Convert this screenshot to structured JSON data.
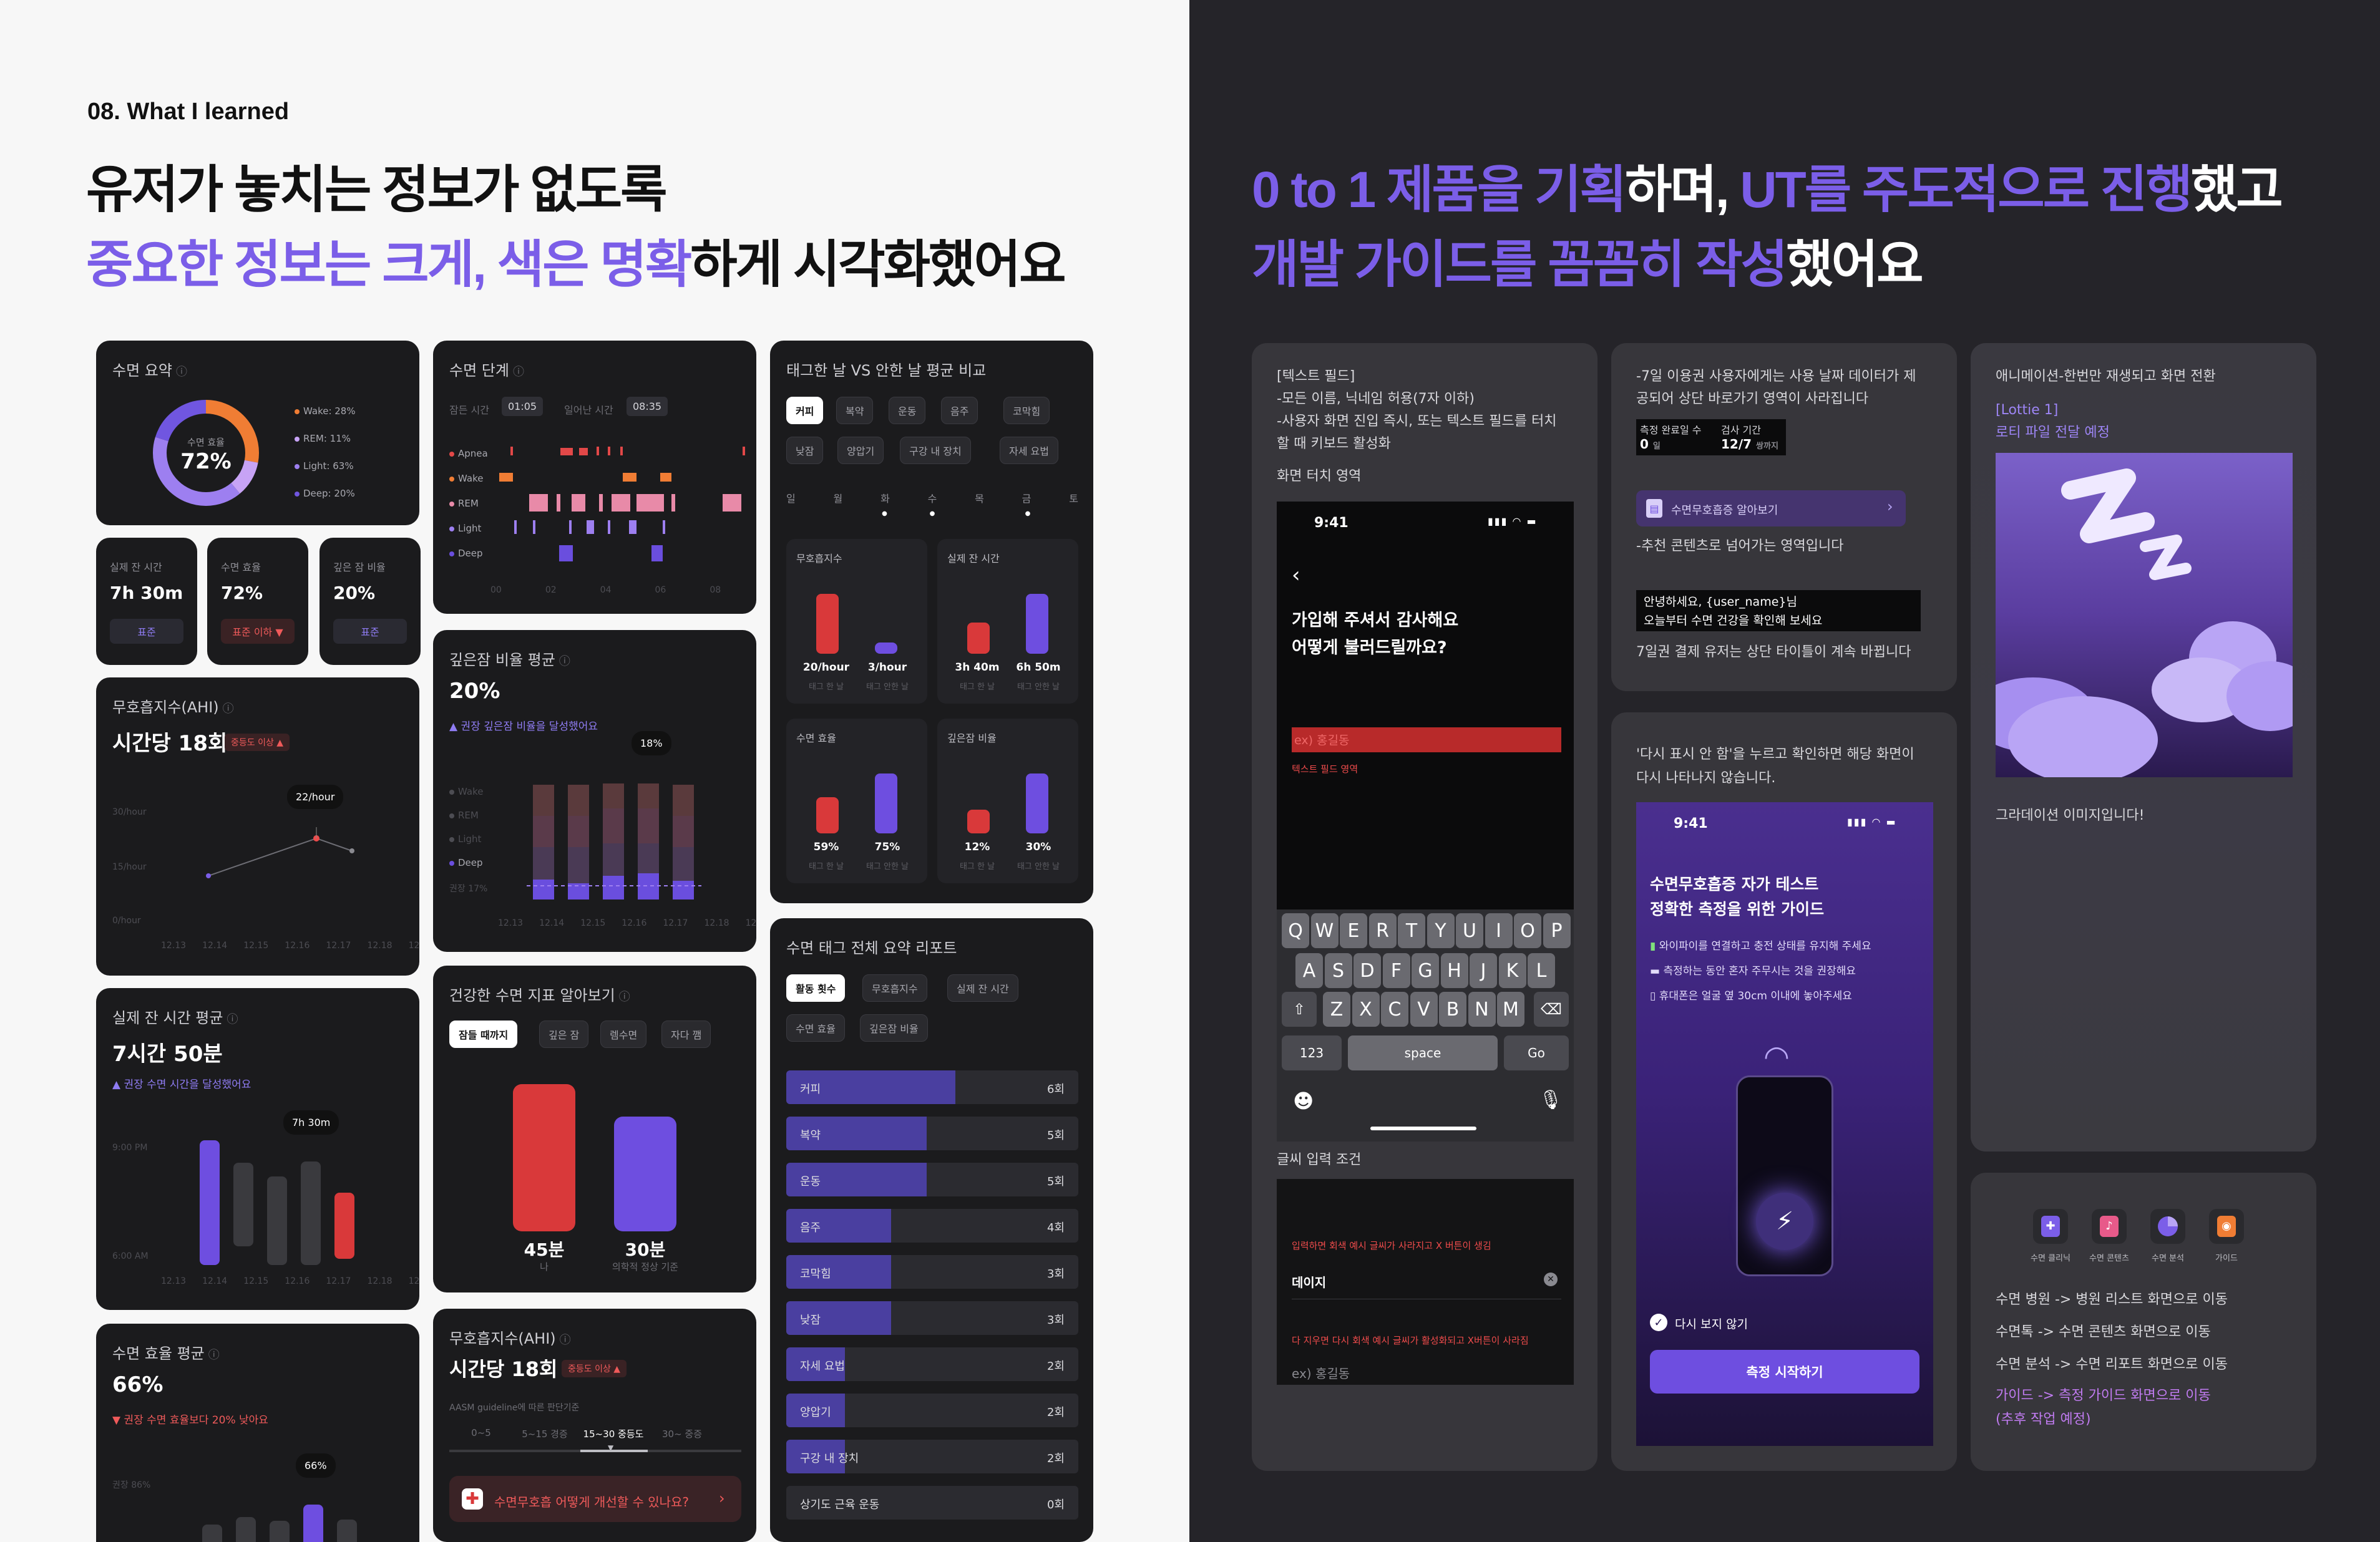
{
  "left_header": {
    "eyebrow": "08. What I learned",
    "line1": "유저가 놓치는 정보가 없도록",
    "line2_accent": "중요한 정보는 크게, 색은 명확",
    "line2_rest": "하게 시각화했어요"
  },
  "right_header": {
    "l1_a": "0 to 1 제품을 기획",
    "l1_b": "하며, ",
    "l1_c": "UT를 주도적으로 진행",
    "l1_d": "했고",
    "l2_a": "개발 가이드를 꼼꼼히 작성",
    "l2_b": "했어요"
  },
  "sleep_summary": {
    "title": "수면 요약",
    "center_label": "수면 효율",
    "center_value": "72%",
    "legend": [
      "Wake: 28%",
      "REM: 11%",
      "Light: 63%",
      "Deep: 20%"
    ],
    "colors": {
      "wake": "#f07d34",
      "rem": "#c7a3f5",
      "light": "#9d7ff0",
      "deep": "#7056e0"
    }
  },
  "mini_stats": [
    {
      "title": "실제 잔 시간",
      "value": "7h 30m",
      "badge": "표준"
    },
    {
      "title": "수면 효율",
      "value": "72%",
      "badge": "표준 이하 ▼"
    },
    {
      "title": "깊은 잠 비율",
      "value": "20%",
      "badge": "표준"
    }
  ],
  "ahi": {
    "title": "무호흡지수(AHI)",
    "value": "시간당 18회",
    "badge": "중등도 이상 ▲",
    "tooltip": "22/hour",
    "y_ticks": [
      "30/hour",
      "15/hour",
      "0/hour"
    ],
    "x_ticks": [
      "12.13",
      "12.14",
      "12.15",
      "12.16",
      "12.17",
      "12.18",
      "12.19"
    ]
  },
  "sleep_time_avg": {
    "title": "실제 잔 시간 평균",
    "value": "7시간 50분",
    "sub": "▲ 권장 수면 시간을 달성했어요",
    "tooltip": "7h 30m",
    "y_ticks": [
      "9:00 PM",
      "6:00 AM"
    ],
    "x_ticks": [
      "12.13",
      "12.14",
      "12.15",
      "12.16",
      "12.17",
      "12.18",
      "12.19"
    ]
  },
  "efficiency_avg": {
    "title": "수면 효율 평균",
    "value": "66%",
    "sub": "▼ 권장 수면 효율보다 20% 낮아요",
    "tooltip": "66%",
    "y_tick": "권장 86%"
  },
  "sleep_stage": {
    "title": "수면 단계",
    "bed_label": "잠든 시간",
    "bed_value": "01:05",
    "wake_label": "일어난 시간",
    "wake_value": "08:35",
    "rows": [
      "Apnea",
      "Wake",
      "REM",
      "Light",
      "Deep"
    ],
    "x_ticks": [
      "00",
      "02",
      "04",
      "06",
      "08"
    ]
  },
  "deep_avg": {
    "title": "깊은잠 비율 평균",
    "value": "20%",
    "sub": "▲ 권장 깊은잠 비율을 달성했어요",
    "tooltip": "18%",
    "legend": [
      "Wake",
      "REM",
      "Light",
      "Deep"
    ],
    "ref": "권장 17%",
    "x_ticks": [
      "12.13",
      "12.14",
      "12.15",
      "12.16",
      "12.17",
      "12.18",
      "12.19"
    ]
  },
  "healthy_index": {
    "title": "건강한 수면 지표 알아보기",
    "tabs": [
      "잠들 때까지",
      "깊은 잠",
      "렘수면",
      "자다 깸"
    ],
    "left_value": "45분",
    "left_label": "나",
    "right_value": "30분",
    "right_label": "의학적 정상 기준"
  },
  "ahi2": {
    "title": "무호흡지수(AHI)",
    "value": "시간당 18회",
    "badge": "중등도 이상 ▲",
    "caption": "AASM guideline에 따른 판단기준",
    "scale": [
      "0~5",
      "5~15 경증",
      "15~30 중등도",
      "30~ 중증"
    ],
    "cta": "수면무호흡 어떻게 개선할 수 있나요?"
  },
  "tag_compare": {
    "title": "태그한 날 VS 안한 날 평균 비교",
    "tags_row1": [
      "커피",
      "복약",
      "운동",
      "음주",
      "코막힘"
    ],
    "tags_row2": [
      "낮잠",
      "양압기",
      "구강 내 장치",
      "자세 요법"
    ],
    "days": [
      "일",
      "월",
      "화",
      "수",
      "목",
      "금",
      "토"
    ],
    "cells": [
      {
        "title": "무호흡지수",
        "a": "20/hour",
        "b": "3/hour",
        "a_pct": 0.85,
        "b_pct": 0.15
      },
      {
        "title": "실제 잔 시간",
        "a": "3h 40m",
        "b": "6h 50m",
        "a_pct": 0.45,
        "b_pct": 0.85
      },
      {
        "title": "수면 효율",
        "a": "59%",
        "b": "75%",
        "a_pct": 0.55,
        "b_pct": 0.85
      },
      {
        "title": "깊은잠 비율",
        "a": "12%",
        "b": "30%",
        "a_pct": 0.35,
        "b_pct": 0.85
      }
    ],
    "a_caption": "태그 한 날",
    "b_caption": "태그 안한 날"
  },
  "tag_report": {
    "title": "수면 태그 전체 요약 리포트",
    "tabs_row1": [
      "활동 횟수",
      "무호흡지수",
      "실제 잔 시간"
    ],
    "tabs_row2": [
      "수면 효율",
      "깊은잠 비율"
    ],
    "rows": [
      {
        "label": "커피",
        "count": "6회",
        "pct": 0.58
      },
      {
        "label": "복약",
        "count": "5회",
        "pct": 0.48
      },
      {
        "label": "운동",
        "count": "5회",
        "pct": 0.48
      },
      {
        "label": "음주",
        "count": "4회",
        "pct": 0.36
      },
      {
        "label": "코막힘",
        "count": "3회",
        "pct": 0.36
      },
      {
        "label": "낮잠",
        "count": "3회",
        "pct": 0.36
      },
      {
        "label": "자세 요법",
        "count": "2회",
        "pct": 0.2
      },
      {
        "label": "양압기",
        "count": "2회",
        "pct": 0.2
      },
      {
        "label": "구강 내 장치",
        "count": "2회",
        "pct": 0.2
      },
      {
        "label": "상기도 근육 운동",
        "count": "0회",
        "pct": 0
      }
    ]
  },
  "guide1": {
    "note1": "[텍스트 필드]",
    "note2": "-모든 이름, 닉네임 허용(7자 이하)",
    "note3": "-사용자 화면 진입 즉시, 또는 텍스트 필드를 터치",
    "note4": "할 때 키보드 활성화",
    "touch_label": "화면 터치 영역",
    "time": "9:41",
    "heading1": "가입해 주셔서 감사해요",
    "heading2": "어떻게 불러드릴까요?",
    "field_placeholder": "ex) 홍길동",
    "field_note": "텍스트 필드 영역",
    "keys_r1": [
      "Q",
      "W",
      "E",
      "R",
      "T",
      "Y",
      "U",
      "I",
      "O",
      "P"
    ],
    "keys_r2": [
      "A",
      "S",
      "D",
      "F",
      "G",
      "H",
      "J",
      "K",
      "L"
    ],
    "keys_r3": [
      "Z",
      "X",
      "C",
      "V",
      "B",
      "N",
      "M"
    ],
    "key_123": "123",
    "key_space": "space",
    "key_go": "Go",
    "cond_label": "글씨 입력 조건",
    "cond1": "입력하면 회색 예시 글씨가 사라지고 X 버튼이 생김",
    "cond_value": "데이지",
    "cond2": "다 지우면 다시 회색 예시 글씨가 활성화되고 X버튼이 사라짐",
    "cond_placeholder": "ex) 홍길동"
  },
  "guide2": {
    "note1": "-7일 이용권 사용자에게는 사용 날짜 데이터가 제",
    "note2": "공되어 상단 바로가기 영역이 사라집니다",
    "stat1_label": "측정 완료일 수",
    "stat1_value": "0",
    "stat1_unit": "일",
    "stat2_label": "검사 기간",
    "stat2_value": "12/7",
    "stat2_unit": "쌍까지",
    "chip": "수면무호흡증 알아보기",
    "note3": "-추천 콘텐츠로 넘어가는 영역입니다",
    "greet1": "안녕하세요, {user_name}님",
    "greet2": "오늘부터 수면 건강을 확인해 보세요",
    "note4": "7일권 결제 유저는 상단 타이틀이 계속 바뀝니다"
  },
  "guide3": {
    "note1": "'다시 표시 안 함'을 누르고 확인하면 해당 화면이",
    "note2": "다시 나타나지 않습니다.",
    "time": "9:41",
    "title1": "수면무호흡증 자가 테스트",
    "title2": "정확한 측정을 위한 가이드",
    "item1": "와이파이를 연결하고 충전 상태를 유지해 주세요",
    "item2": "측정하는 동안 혼자 주무시는 것을 권장해요",
    "item3": "휴대폰은 얼굴 옆 30cm 이내에 놓아주세요",
    "checkbox": "다시 보지 않기",
    "cta": "측정 시작하기"
  },
  "guide4": {
    "note1": "애니메이션-한번만 재생되고 화면 전환",
    "lottie1": "[Lottie 1]",
    "lottie2": "로티 파일 전달 예정",
    "caption": "그라데이션 이미지입니다!"
  },
  "guide5": {
    "icons": [
      "수면 클리닉",
      "수면 콘텐츠",
      "수면 분석",
      "가이드"
    ],
    "line1": "수면 병원 -> 병원 리스트 화면으로 이동",
    "line2": "수면톡 -> 수면 콘텐츠 화면으로 이동",
    "line3": "수면 분석 -> 수면 리포트 화면으로 이동",
    "line4": "가이드 -> 측정 가이드 화면으로 이동",
    "line5": "(추후 작업 예정)"
  }
}
